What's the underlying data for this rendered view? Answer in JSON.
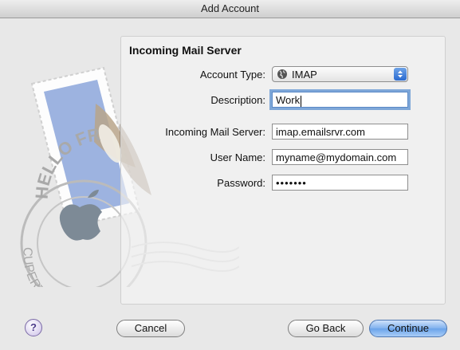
{
  "window": {
    "title": "Add Account"
  },
  "section": {
    "heading": "Incoming Mail Server"
  },
  "form": {
    "account_type": {
      "label": "Account Type:",
      "value": "IMAP"
    },
    "description": {
      "label": "Description:",
      "value": "Work"
    },
    "incoming_server": {
      "label": "Incoming Mail Server:",
      "value": "imap.emailsrvr.com"
    },
    "user_name": {
      "label": "User Name:",
      "value": "myname@mydomain.com"
    },
    "password": {
      "label": "Password:",
      "value": "•••••••"
    }
  },
  "stamp": {
    "text_top": "HELLO FR",
    "text_bottom": "CUPERTINO, CA"
  },
  "buttons": {
    "help": "?",
    "cancel": "Cancel",
    "go_back": "Go Back",
    "continue": "Continue"
  },
  "colors": {
    "focus_ring": "#7ea7d8",
    "default_button": "#6aa3ea",
    "stamp_blue": "#9db3e0"
  }
}
